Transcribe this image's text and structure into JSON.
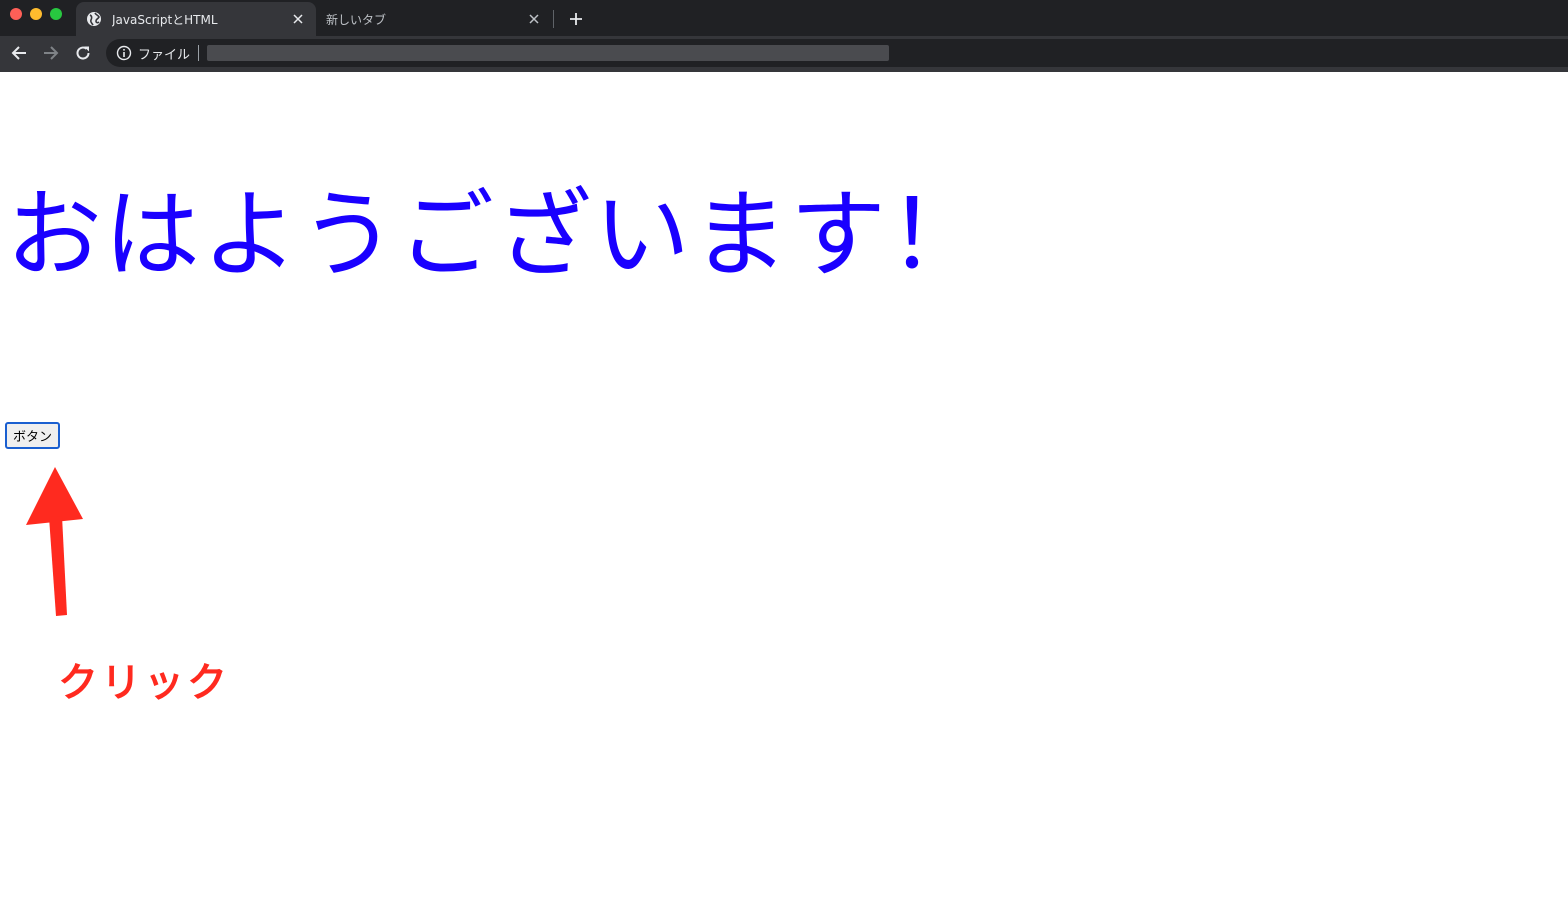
{
  "browser": {
    "tabs": [
      {
        "title": "JavaScriptとHTML",
        "icon": "globe-icon",
        "active": true
      },
      {
        "title": "新しいタブ",
        "icon": "",
        "active": false
      }
    ],
    "new_tab_icon": "plus-icon",
    "toolbar": {
      "back_icon": "arrow-left-icon",
      "forward_icon": "arrow-right-icon",
      "reload_icon": "reload-icon"
    },
    "omnibox": {
      "security_icon": "info-icon",
      "scheme_label": "ファイル",
      "url": ""
    }
  },
  "page": {
    "heading": "おはようございます！",
    "heading_color": "#1a00ff",
    "button_label": "ボタン"
  },
  "annotation": {
    "label": "クリック",
    "color": "#ff2a1f",
    "arrow_icon": "arrow-up-icon"
  }
}
